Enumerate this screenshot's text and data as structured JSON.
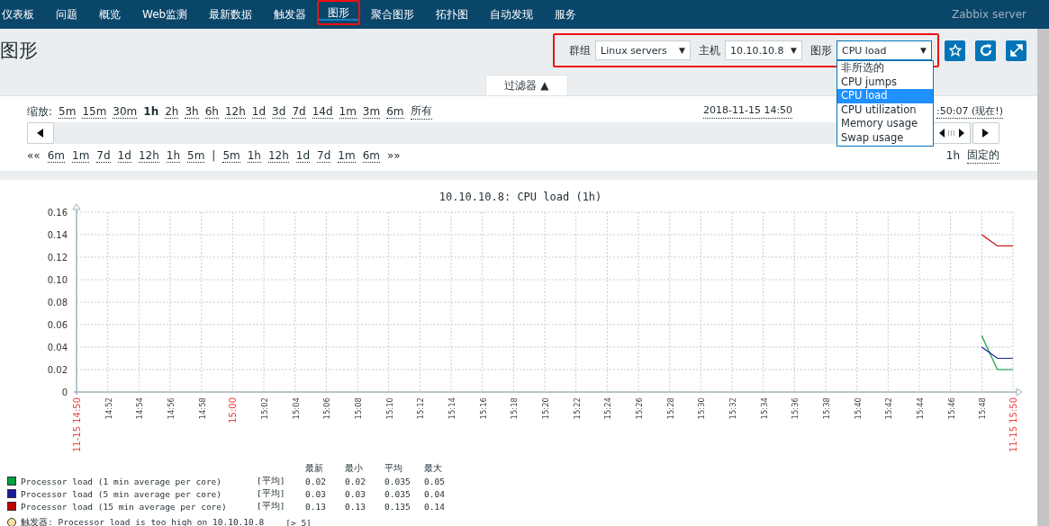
{
  "nav": {
    "items": [
      {
        "label": "仪表板",
        "selected": false,
        "highlighted": false
      },
      {
        "label": "问题",
        "selected": false,
        "highlighted": false
      },
      {
        "label": "概览",
        "selected": false,
        "highlighted": false
      },
      {
        "label": "Web监测",
        "selected": false,
        "highlighted": false
      },
      {
        "label": "最新数据",
        "selected": false,
        "highlighted": false
      },
      {
        "label": "触发器",
        "selected": false,
        "highlighted": false
      },
      {
        "label": "图形",
        "selected": true,
        "highlighted": true
      },
      {
        "label": "聚合图形",
        "selected": false,
        "highlighted": false
      },
      {
        "label": "拓扑图",
        "selected": false,
        "highlighted": false
      },
      {
        "label": "自动发现",
        "selected": false,
        "highlighted": false
      },
      {
        "label": "服务",
        "selected": false,
        "highlighted": false
      }
    ],
    "server": "Zabbix server"
  },
  "page_title": "图形",
  "filters": {
    "highlighted": true,
    "group_label": "群组",
    "group": "Linux servers",
    "host_label": "主机",
    "host": "10.10.10.8",
    "graph_label": "图形",
    "graph": "CPU load",
    "group_caret": "▼",
    "host_caret": "▼",
    "graph_caret": "▼",
    "graph_options": [
      {
        "label": "非所选的",
        "selected": false
      },
      {
        "label": "CPU jumps",
        "selected": false
      },
      {
        "label": "CPU load",
        "selected": true
      },
      {
        "label": "CPU utilization",
        "selected": false
      },
      {
        "label": "Memory usage",
        "selected": false
      },
      {
        "label": "Swap usage",
        "selected": false
      }
    ]
  },
  "filter_tab": {
    "label": "过滤器",
    "arrow": "▲"
  },
  "time": {
    "zoom_label": "缩放:",
    "zoom": [
      {
        "label": "5m",
        "selected": false
      },
      {
        "label": "15m",
        "selected": false
      },
      {
        "label": "30m",
        "selected": false
      },
      {
        "label": "1h",
        "selected": true
      },
      {
        "label": "2h",
        "selected": false
      },
      {
        "label": "3h",
        "selected": false
      },
      {
        "label": "6h",
        "selected": false
      },
      {
        "label": "12h",
        "selected": false
      },
      {
        "label": "1d",
        "selected": false
      },
      {
        "label": "3d",
        "selected": false
      },
      {
        "label": "7d",
        "selected": false
      },
      {
        "label": "14d",
        "selected": false
      },
      {
        "label": "1m",
        "selected": false
      },
      {
        "label": "3m",
        "selected": false
      },
      {
        "label": "6m",
        "selected": false
      },
      {
        "label": "所有",
        "selected": false
      }
    ],
    "range_start": "2018-11-15 14:50",
    "range_end": ":50:07 (现在!)",
    "back": "««",
    "back_steps": [
      "6m",
      "1m",
      "7d",
      "1d",
      "12h",
      "1h",
      "5m"
    ],
    "separator": "|",
    "forward_steps": [
      "5m",
      "1h",
      "12h",
      "1d",
      "7d",
      "1m",
      "6m"
    ],
    "forward": "»»",
    "period": "1h",
    "fixed": "固定的"
  },
  "graph": {
    "chart_data": {
      "type": "line",
      "title": "10.10.10.8: CPU load (1h)",
      "categories": [
        "11-15 14:50",
        null,
        "14:52",
        null,
        "14:54",
        null,
        "14:56",
        null,
        "14:58",
        null,
        "15:00",
        null,
        "15:02",
        null,
        "15:04",
        null,
        "15:06",
        null,
        "15:08",
        null,
        "15:10",
        null,
        "15:12",
        null,
        "15:14",
        null,
        "15:16",
        null,
        "15:18",
        null,
        "15:20",
        null,
        "15:22",
        null,
        "15:24",
        null,
        "15:26",
        null,
        "15:28",
        null,
        "15:30",
        null,
        "15:32",
        null,
        "15:34",
        null,
        "15:36",
        null,
        "15:38",
        null,
        "15:40",
        null,
        "15:42",
        null,
        "15:44",
        null,
        "15:46",
        null,
        "15:48",
        null,
        "11-15 15:50"
      ],
      "ylim": [
        0,
        0.16
      ],
      "yticks": [
        {
          "value": 0,
          "label": "0"
        },
        {
          "value": 0.02,
          "label": "0.02"
        },
        {
          "value": 0.04,
          "label": "0.04"
        },
        {
          "value": 0.06,
          "label": "0.06"
        },
        {
          "value": 0.08,
          "label": "0.08"
        },
        {
          "value": 0.1,
          "label": "0.10"
        },
        {
          "value": 0.12,
          "label": "0.12"
        },
        {
          "value": 0.14,
          "label": "0.14"
        },
        {
          "value": 0.16,
          "label": "0.16"
        }
      ],
      "series": [
        {
          "name": "Processor load (1 min average per core)",
          "color": "#00a040",
          "values": [
            null,
            null,
            null,
            null,
            null,
            null,
            null,
            null,
            null,
            null,
            null,
            null,
            null,
            null,
            null,
            null,
            null,
            null,
            null,
            null,
            null,
            null,
            null,
            null,
            null,
            null,
            null,
            null,
            null,
            null,
            null,
            null,
            null,
            null,
            null,
            null,
            null,
            null,
            null,
            null,
            null,
            null,
            null,
            null,
            null,
            null,
            null,
            null,
            null,
            null,
            null,
            null,
            null,
            null,
            null,
            null,
            null,
            null,
            0.05,
            0.02,
            0.02
          ]
        },
        {
          "name": "Processor load (5 min average per core)",
          "color": "#1a1a9a",
          "values": [
            null,
            null,
            null,
            null,
            null,
            null,
            null,
            null,
            null,
            null,
            null,
            null,
            null,
            null,
            null,
            null,
            null,
            null,
            null,
            null,
            null,
            null,
            null,
            null,
            null,
            null,
            null,
            null,
            null,
            null,
            null,
            null,
            null,
            null,
            null,
            null,
            null,
            null,
            null,
            null,
            null,
            null,
            null,
            null,
            null,
            null,
            null,
            null,
            null,
            null,
            null,
            null,
            null,
            null,
            null,
            null,
            null,
            null,
            0.04,
            0.03,
            0.03
          ]
        },
        {
          "name": "Processor load (15 min average per core)",
          "color": "#c00000",
          "values": [
            null,
            null,
            null,
            null,
            null,
            null,
            null,
            null,
            null,
            null,
            null,
            null,
            null,
            null,
            null,
            null,
            null,
            null,
            null,
            null,
            null,
            null,
            null,
            null,
            null,
            null,
            null,
            null,
            null,
            null,
            null,
            null,
            null,
            null,
            null,
            null,
            null,
            null,
            null,
            null,
            null,
            null,
            null,
            null,
            null,
            null,
            null,
            null,
            null,
            null,
            null,
            null,
            null,
            null,
            null,
            null,
            null,
            null,
            0.14,
            0.13,
            0.13
          ]
        }
      ],
      "grid": true
    },
    "legend_headers": [
      "最新",
      "最小",
      "平均",
      "最大"
    ],
    "legend": [
      {
        "func": "[平均]",
        "values": [
          "0.02",
          "0.02",
          "0.035",
          "0.05"
        ]
      },
      {
        "func": "[平均]",
        "values": [
          "0.03",
          "0.03",
          "0.035",
          "0.04"
        ]
      },
      {
        "func": "[平均]",
        "values": [
          "0.13",
          "0.13",
          "0.135",
          "0.14"
        ]
      }
    ],
    "trigger": {
      "label": "触发器: Processor load is too high on 10.10.10.8",
      "threshold": "[> 5]"
    }
  }
}
